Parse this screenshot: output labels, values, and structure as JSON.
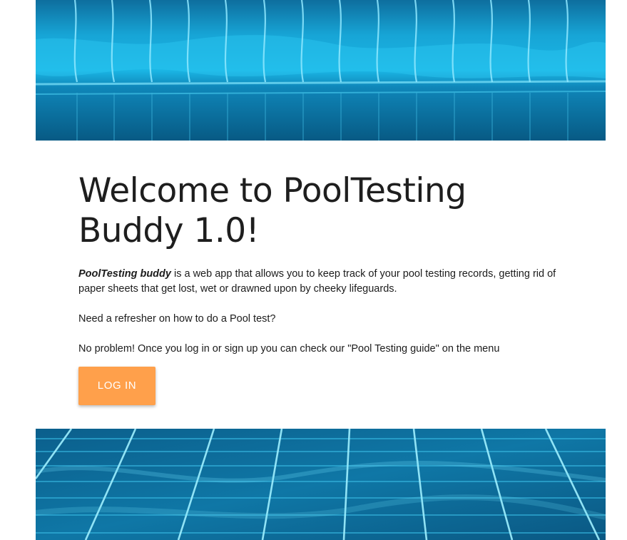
{
  "header_image": {
    "description_icon": "pool-water-icon"
  },
  "main": {
    "title": "Welcome to PoolTesting Buddy 1.0!",
    "intro_brand": "PoolTesting buddy",
    "intro_rest": " is a web app that allows you to keep track of your pool testing records, getting rid of paper sheets that get lost, wet or drawned upon by cheeky lifeguards.",
    "refresher": "Need a refresher on how to do a Pool test?",
    "guide_note": "No problem! Once you log in or sign up you can check our \"Pool Testing guide\" on the menu",
    "login_label": "LOG IN"
  },
  "colors": {
    "accent": "#ffa04b",
    "water_dark": "#0a5f8a",
    "water_light": "#19b6e6"
  }
}
